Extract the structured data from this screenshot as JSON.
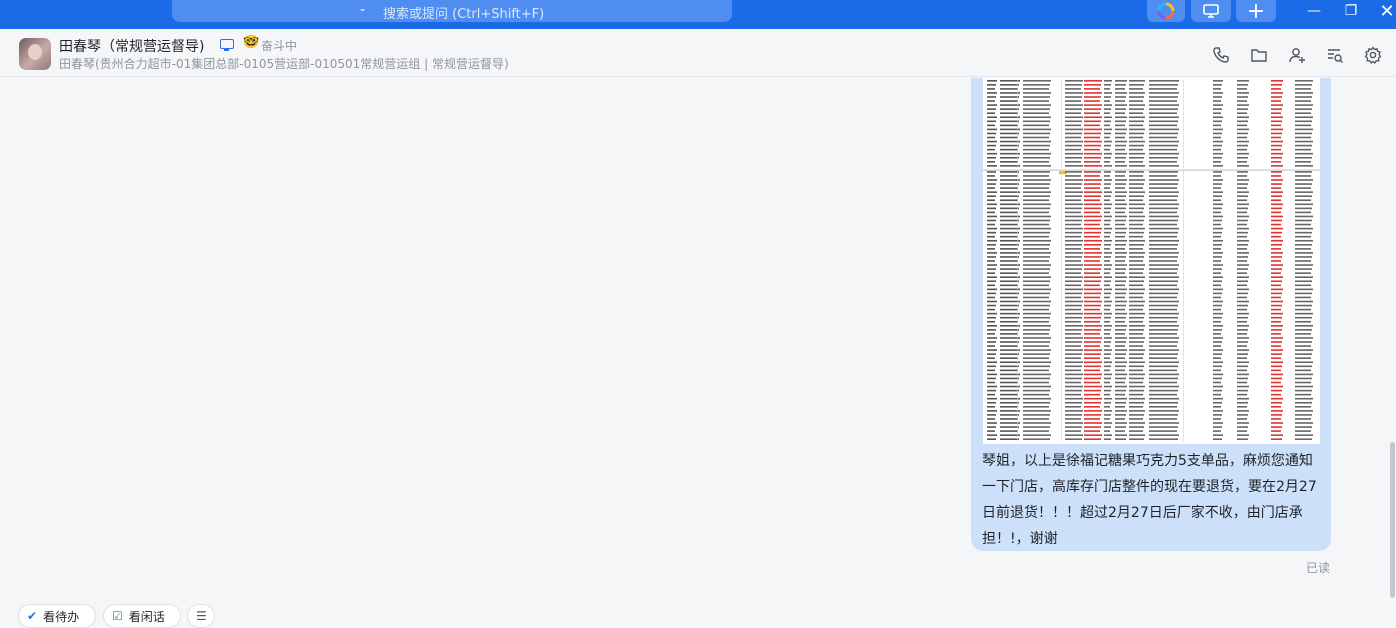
{
  "topbar": {
    "search_placeholder": "搜索或提问 (Ctrl+Shift+F)",
    "search_prefix": "-",
    "new_label": "+",
    "min_label": "—",
    "max_label": "❐",
    "close_label": "✕"
  },
  "header": {
    "name": "田春琴（常规营运督导)",
    "status": "奋斗中",
    "status_emoji": "🤓",
    "subtitle": "田春琴(贵州合力超市-01集团总部-0105营运部-010501常规营运组 | 常规营运督导)"
  },
  "message": {
    "text": "琴姐，以上是徐福记糖果巧克力5支单品，麻烦您通知一下门店，高库存门店整件的现在要退货，要在2月27日前退货！！！超过2月27日后厂家不收，由门店承担！!，谢谢",
    "read_status": "已读"
  },
  "quick_actions": [
    {
      "label": "看待办",
      "icon": "✔"
    },
    {
      "label": "看闲话",
      "icon": "☑"
    },
    {
      "label": "",
      "icon": "☰"
    }
  ],
  "colors": {
    "topbar": "#1c6be6",
    "bubble": "#cce0fa",
    "accent": "#2f6fe4"
  }
}
